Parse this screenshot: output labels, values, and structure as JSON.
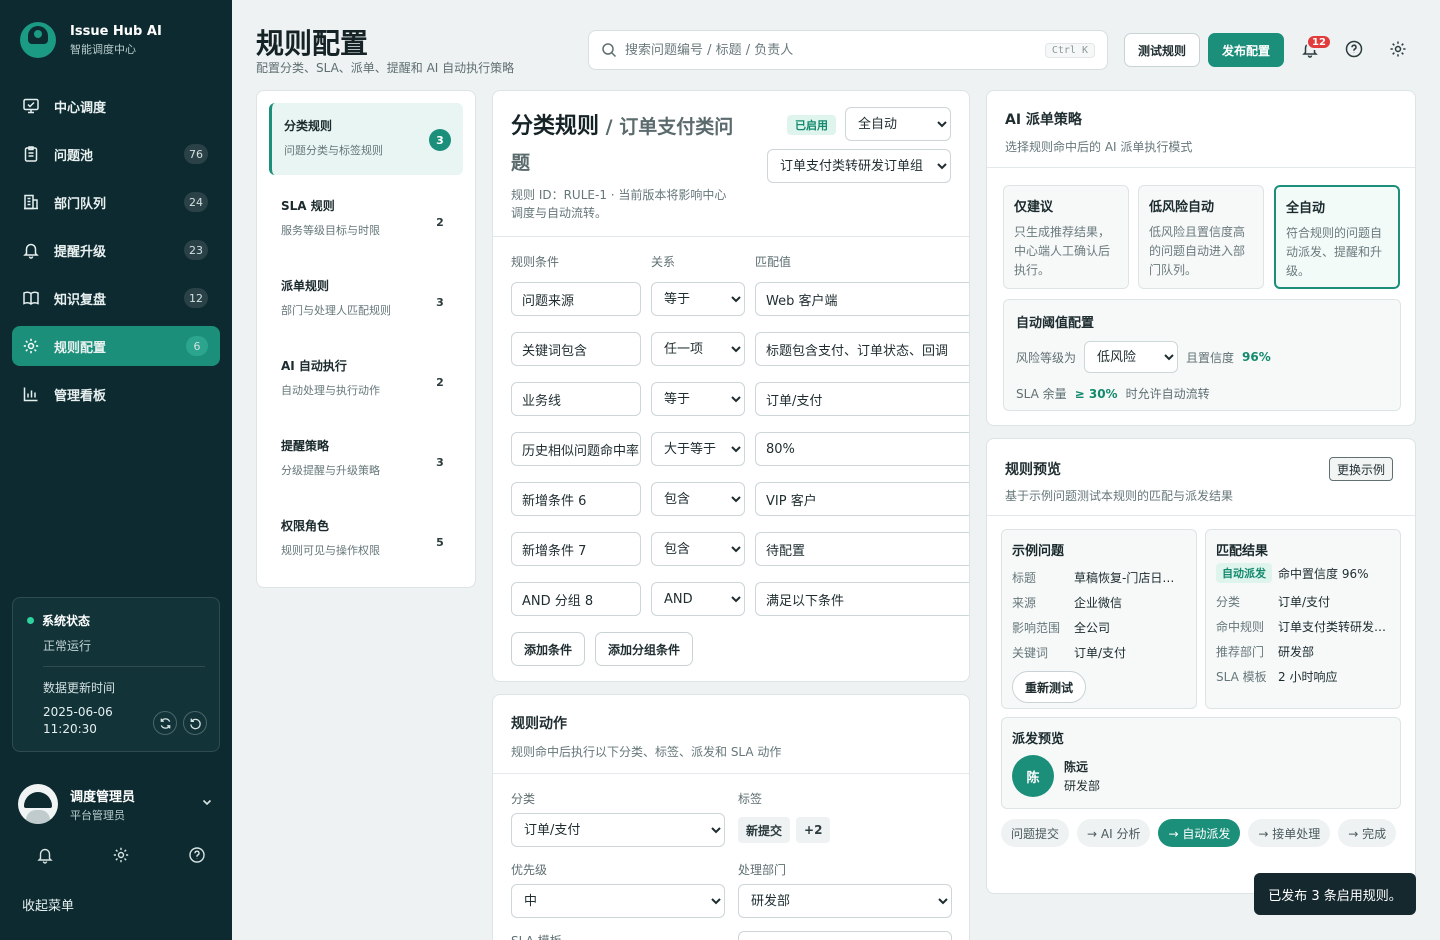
{
  "brand": {
    "name": "Issue Hub AI",
    "subtitle": "智能调度中心"
  },
  "nav": [
    {
      "label": "中心调度",
      "count": "",
      "icon": "monitor-icon"
    },
    {
      "label": "问题池",
      "count": "76",
      "icon": "clipboard-icon"
    },
    {
      "label": "部门队列",
      "count": "24",
      "icon": "building-icon"
    },
    {
      "label": "提醒升级",
      "count": "23",
      "icon": "bell-icon"
    },
    {
      "label": "知识复盘",
      "count": "12",
      "icon": "book-icon"
    },
    {
      "label": "规则配置",
      "count": "6",
      "icon": "gear-icon",
      "active": true
    },
    {
      "label": "管理看板",
      "count": "",
      "icon": "bar-chart-icon"
    }
  ],
  "system_status": {
    "title": "系统状态",
    "state": "正常运行",
    "updated_label": "数据更新时间",
    "updated_time": "2025-06-06 11:20:30"
  },
  "user": {
    "name": "调度管理员",
    "role": "平台管理员"
  },
  "collapse_label": "收起菜单",
  "header": {
    "title": "规则配置",
    "subtitle": "配置分类、SLA、派单、提醒和 AI 自动执行策略",
    "search_placeholder": "搜索问题编号 / 标题 / 负责人",
    "search_shortcut": "Ctrl K",
    "test_label": "测试规则",
    "publish_label": "发布配置",
    "notification_count": "12"
  },
  "rule_categories": [
    {
      "title": "分类规则",
      "desc": "问题分类与标签规则",
      "count": "3",
      "active": true
    },
    {
      "title": "SLA 规则",
      "desc": "服务等级目标与时限",
      "count": "2"
    },
    {
      "title": "派单规则",
      "desc": "部门与处理人匹配规则",
      "count": "3"
    },
    {
      "title": "AI 自动执行",
      "desc": "自动处理与执行动作",
      "count": "2"
    },
    {
      "title": "提醒策略",
      "desc": "分级提醒与升级策略",
      "count": "3"
    },
    {
      "title": "权限角色",
      "desc": "规则可见与操作权限",
      "count": "5"
    }
  ],
  "editor": {
    "title": "分类规则",
    "title_sep": " / ",
    "rule_name": "订单支付类问题",
    "status": "已启用",
    "mode_value": "全自动",
    "flow_value": "订单支付类转研发订单组",
    "meta": "规则 ID：RULE-1 · 当前版本将影响中心调度与自动流转。",
    "col_condition": "规则条件",
    "col_relation": "关系",
    "col_value": "匹配值",
    "conditions": [
      {
        "field": "问题来源",
        "relation": "等于",
        "value": "Web 客户端"
      },
      {
        "field": "关键词包含",
        "relation": "任一项",
        "value": "标题包含支付、订单状态、回调"
      },
      {
        "field": "业务线",
        "relation": "等于",
        "value": "订单/支付"
      },
      {
        "field": "历史相似问题命中率",
        "relation": "大于等于",
        "value": "80%"
      },
      {
        "field": "新增条件 6",
        "relation": "包含",
        "value": "VIP 客户"
      },
      {
        "field": "新增条件 7",
        "relation": "包含",
        "value": "待配置"
      },
      {
        "field": "AND 分组 8",
        "relation": "AND",
        "value": "满足以下条件"
      }
    ],
    "add_condition": "添加条件",
    "add_group": "添加分组条件"
  },
  "actions": {
    "title": "规则动作",
    "subtitle": "规则命中后执行以下分类、标签、派发和 SLA 动作",
    "category_label": "分类",
    "category_value": "订单/支付",
    "tags_label": "标签",
    "tags": [
      "新提交",
      "+2"
    ],
    "priority_label": "优先级",
    "priority_value": "中",
    "dept_label": "处理部门",
    "dept_value": "研发部",
    "sla_label": "SLA 模板"
  },
  "ai_strategy": {
    "title": "AI 派单策略",
    "subtitle": "选择规则命中后的 AI 派单执行模式",
    "modes": [
      {
        "title": "仅建议",
        "desc": "只生成推荐结果，中心端人工确认后执行。"
      },
      {
        "title": "低风险自动",
        "desc": "低风险且置信度高的问题自动进入部门队列。"
      },
      {
        "title": "全自动",
        "desc": "符合规则的问题自动派发、提醒和升级。",
        "active": true
      }
    ],
    "threshold_title": "自动阈值配置",
    "risk_label": "风险等级为",
    "risk_value": "低风险",
    "conf_label": "且置信度",
    "conf_value": "96%",
    "sla_prefix": "SLA 余量",
    "sla_value": "≥ 30%",
    "sla_suffix": "时允许自动流转"
  },
  "preview": {
    "title": "规则预览",
    "subtitle": "基于示例问题测试本规则的匹配与派发结果",
    "change_label": "更换示例",
    "sample": {
      "title": "示例问题",
      "fields": [
        {
          "k": "标题",
          "v": "草稿恢复-门店日志异常"
        },
        {
          "k": "来源",
          "v": "企业微信"
        },
        {
          "k": "影响范围",
          "v": "全公司"
        },
        {
          "k": "关键词",
          "v": "订单/支付"
        }
      ],
      "retest_label": "重新测试"
    },
    "result": {
      "title": "匹配结果",
      "auto_tag": "自动派发",
      "confidence": "命中置信度 96%",
      "fields": [
        {
          "k": "分类",
          "v": "订单/支付"
        },
        {
          "k": "命中规则",
          "v": "订单支付类转研发订单组"
        },
        {
          "k": "推荐部门",
          "v": "研发部"
        },
        {
          "k": "SLA 模板",
          "v": "2 小时响应"
        }
      ]
    },
    "dispatch": {
      "title": "派发预览",
      "avatar": "陈",
      "name": "陈远",
      "dept": "研发部"
    },
    "flow": [
      "问题提交",
      "→ AI 分析",
      "→ 自动派发",
      "→ 接单处理",
      "→ 完成"
    ],
    "flow_active_index": 2
  },
  "toast": "已发布 3 条启用规则。"
}
